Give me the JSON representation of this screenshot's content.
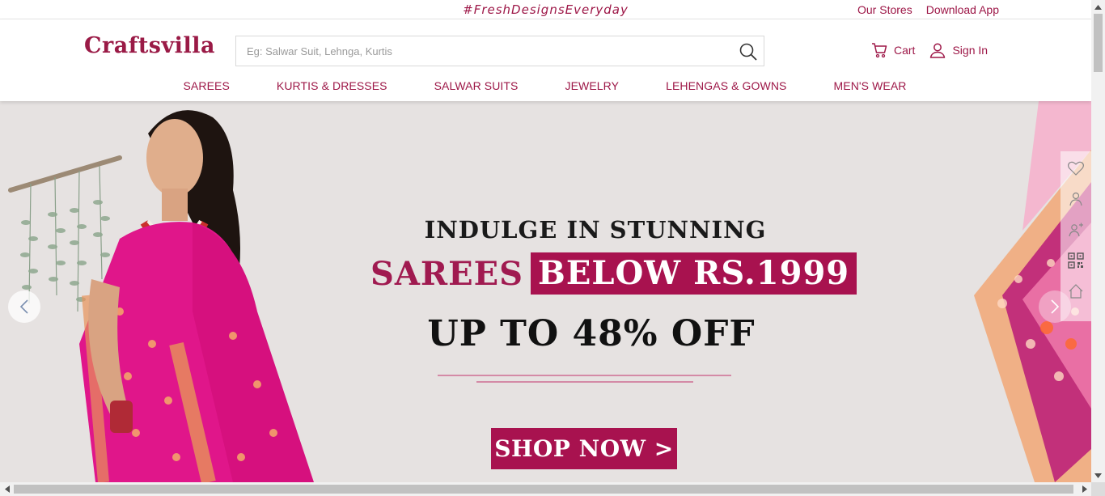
{
  "top_strip": {
    "tagline": "#FreshDesignsEveryday",
    "links": [
      "Our Stores",
      "Download App"
    ]
  },
  "header": {
    "logo": "Craftsvilla",
    "search_placeholder": "Eg: Salwar Suit, Lehnga, Kurtis",
    "cart_label": "Cart",
    "signin_label": "Sign In"
  },
  "nav": [
    "SAREES",
    "KURTIS & DRESSES",
    "SALWAR SUITS",
    "JEWELRY",
    "LEHENGAS & GOWNS",
    "MEN'S WEAR"
  ],
  "banner": {
    "line1": "INDULGE IN STUNNING",
    "line2_plain": "SAREES",
    "line2_boxed": "BELOW RS.1999",
    "line3": "UP TO 48% OFF",
    "cta": "SHOP NOW >"
  },
  "side_rail_icons": [
    "heart-icon",
    "user-pin-icon",
    "user-share-icon",
    "qr-code-icon",
    "home-icon"
  ],
  "colors": {
    "brand": "#9d1747",
    "banner_bg": "#e6e2e1",
    "cta_bg": "#a8124f",
    "saree_pink": "#e0168a"
  }
}
